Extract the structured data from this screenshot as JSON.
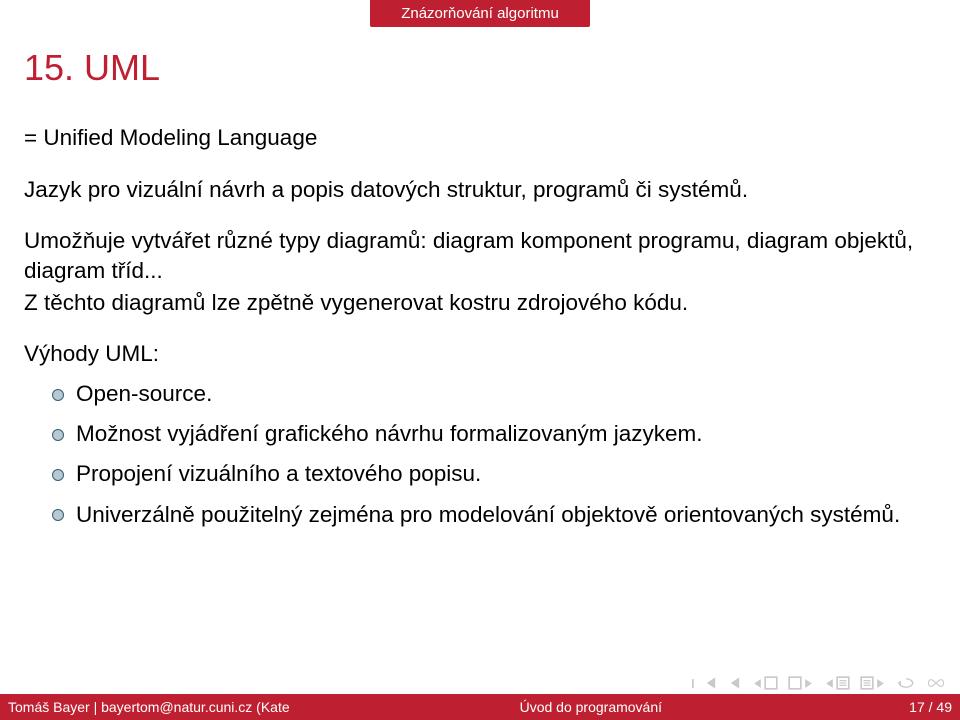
{
  "header": {
    "section_label": "Znázorňování algoritmu"
  },
  "title": "15. UML",
  "body": {
    "p1": "= Unified Modeling Language",
    "p2": "Jazyk pro vizuální návrh a popis datových struktur, programů či systémů.",
    "p3a": "Umožňuje vytvářet různé typy diagramů: diagram komponent programu, diagram objektů, diagram tříd...",
    "p3b": "Z těchto diagramů lze zpětně vygenerovat kostru zdrojového kódu.",
    "p4": "Výhody UML:",
    "bullets": [
      "Open-source.",
      "Možnost vyjádření grafického návrhu formalizovaným jazykem.",
      "Propojení vizuálního a textového popisu.",
      "Univerzálně použitelný zejména pro modelování objektově orientovaných systémů."
    ]
  },
  "nav_icons": {
    "first": "nav-first-icon",
    "prev": "nav-prev-icon",
    "next": "nav-next-icon",
    "last": "nav-last-icon",
    "back": "nav-back-icon",
    "search": "nav-search-icon",
    "loop": "nav-loop-icon"
  },
  "footer": {
    "author": "Tomáš Bayer | bayertom@natur.cuni.cz (Kate",
    "center": "Úvod do programování",
    "page": "17 / 49"
  },
  "colors": {
    "accent": "#bf2031",
    "bullet_fill": "#b9c8d0",
    "bullet_border": "#2f5f7a",
    "nav_muted": "#c9c9c9"
  }
}
